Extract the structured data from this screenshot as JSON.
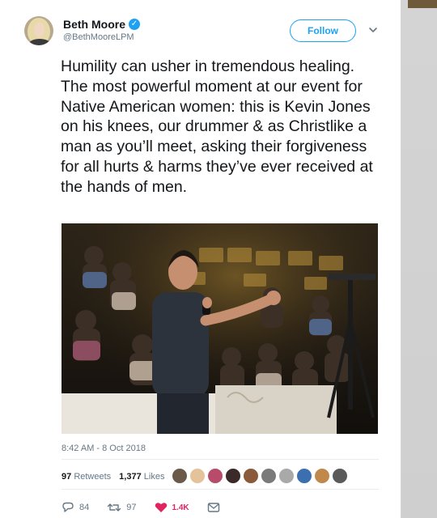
{
  "tweet": {
    "author": {
      "name": "Beth Moore",
      "handle": "@BethMooreLPM",
      "verified": true
    },
    "follow_label": "Follow",
    "text": "Humility can usher in tremendous healing. The most powerful moment at our event for Native American women: this is Kevin Jones on his knees, our drummer & as Christlike a man as you’ll meet, asking their forgiveness for all hurts & harms they’ve ever received at the hands of men.",
    "timestamp": "8:42 AM - 8 Oct 2018",
    "retweets": {
      "count": "97",
      "label": "Retweets"
    },
    "likes": {
      "count": "1,377",
      "label": "Likes"
    },
    "actions": {
      "replies": "84",
      "retweets": "97",
      "likes": "1.4K"
    }
  },
  "colors": {
    "accent": "#1da1f2",
    "like": "#e0245e",
    "muted": "#657786"
  },
  "icons": [
    "verified-badge-icon",
    "chevron-down-icon",
    "reply-icon",
    "retweet-icon",
    "heart-icon",
    "direct-message-icon"
  ]
}
